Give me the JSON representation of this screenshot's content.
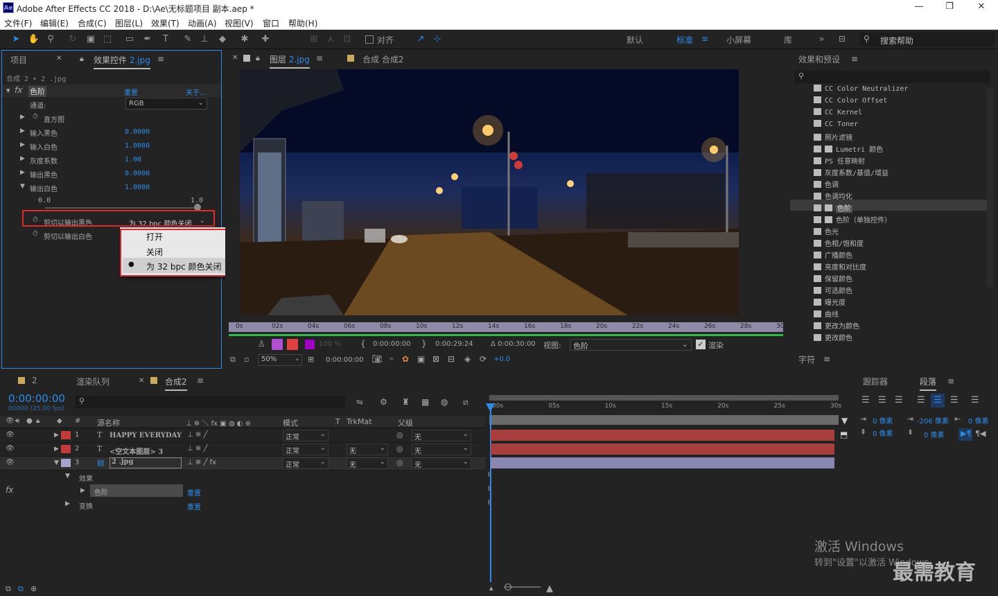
{
  "app": {
    "title": "Adobe After Effects CC 2018 - D:\\Ae\\无标题项目 副本.aep *",
    "icon": "Ae"
  },
  "menu": [
    "文件(F)",
    "编辑(E)",
    "合成(C)",
    "图层(L)",
    "效果(T)",
    "动画(A)",
    "视图(V)",
    "窗口",
    "帮助(H)"
  ],
  "toolbar": {
    "snap_label": "对齐",
    "workspaces": [
      "默认",
      "标准",
      "小屏幕",
      "库"
    ],
    "search_placeholder": "搜索帮助"
  },
  "left_panel": {
    "tab_project": "项目",
    "tab_effects": "效果控件",
    "tab_effects_file": "2.jpg",
    "breadcrumb": "合成 2 • 2 .jpg",
    "effect_name": "色阶",
    "reset": "重置",
    "about": "关于...",
    "channel_label": "通道:",
    "channel_value": "RGB",
    "props": [
      {
        "label": "直方图",
        "value": ""
      },
      {
        "label": "输入黑色",
        "value": "0.0000"
      },
      {
        "label": "输入白色",
        "value": "1.0000"
      },
      {
        "label": "灰度系数",
        "value": "1.00"
      },
      {
        "label": "输出黑色",
        "value": "0.0000"
      },
      {
        "label": "输出白色",
        "value": "1.0000"
      }
    ],
    "slider_min": "0.0",
    "slider_max": "1.0",
    "clip_black_label": "剪切以输出黑色",
    "clip_black_value": "为 32 bpc 颜色关闭",
    "clip_white_label": "剪切以输出白色",
    "dropdown_options": [
      "打开",
      "关闭",
      "为 32 bpc 颜色关闭"
    ],
    "dropdown_selected": "为 32 bpc 颜色关闭"
  },
  "viewer_panel": {
    "tab_layer": "图层",
    "tab_layer_file": "2.jpg",
    "tab_comp": "合成 合成2",
    "ruler_ticks": [
      "0s",
      "02s",
      "04s",
      "06s",
      "08s",
      "10s",
      "12s",
      "14s",
      "16s",
      "18s",
      "20s",
      "22s",
      "24s",
      "26s",
      "28s",
      "30"
    ],
    "opacity": "100 %",
    "time_in": "0:00:00:00",
    "time_out": "0:00:29:24",
    "duration": "Δ 0:00:30:00",
    "view_label": "视图:",
    "view_value": "色阶",
    "render_label": "渲染",
    "zoom": "50%",
    "timecode": "0:00:00:00",
    "exposure": "+0.0"
  },
  "effects_panel": {
    "title": "效果和预设",
    "items": [
      "CC Color Neutralizer",
      "CC Color Offset",
      "CC Kernel",
      "CC Toner",
      "照片滤镜",
      "Lumetri 颜色",
      "PS 任意映射",
      "灰度系数/基值/增益",
      "色调",
      "色调均化",
      "色阶",
      "色阶（单独控件）",
      "色光",
      "色相/饱和度",
      "广播颜色",
      "亮度和对比度",
      "保留颜色",
      "可选颜色",
      "曝光度",
      "曲线",
      "更改为颜色",
      "更改颜色"
    ],
    "selected": "色阶"
  },
  "char_panel": {
    "title": "字符"
  },
  "right_bottom": {
    "tab_tracker": "跟踪器",
    "tab_paragraph": "段落",
    "indent_left": "0 像素",
    "indent_first": "-206 像素",
    "indent_right": "0 像素",
    "space_before": "0 像素",
    "space_after": "0 像素"
  },
  "timeline": {
    "tab_num": "2",
    "tab_render": "渲染队列",
    "tab_comp": "合成2",
    "timecode": "0:00:00:00",
    "fps": "00000 (25.00 fps)",
    "headers": {
      "source": "源名称",
      "mode": "模式",
      "t": "T",
      "trkmat": "TrkMat",
      "parent": "父级"
    },
    "layers": [
      {
        "num": "1",
        "type": "T",
        "name": "HAPPY EVERYDAY",
        "mode": "正常",
        "trkmat": "",
        "parent": "无",
        "color": "#c23a3a"
      },
      {
        "num": "2",
        "type": "T",
        "name": "<空文本图层> 3",
        "mode": "正常",
        "trkmat": "无",
        "parent": "无",
        "color": "#c23a3a"
      },
      {
        "num": "3",
        "type": "img",
        "name": "2 .jpg",
        "mode": "正常",
        "trkmat": "无",
        "parent": "无",
        "color": "#a3a3cc"
      }
    ],
    "sub_effects": "效果",
    "sub_levels": "色阶",
    "sub_reset": "重置",
    "sub_transform": "变换",
    "sub_reset2": "重置",
    "ruler_ticks": [
      "00s",
      "05s",
      "10s",
      "15s",
      "20s",
      "25s",
      "30s"
    ]
  },
  "watermark": {
    "line1": "激活 Windows",
    "line2": "转到\"设置\"以激活 Windows。",
    "brand": "最需教育"
  }
}
